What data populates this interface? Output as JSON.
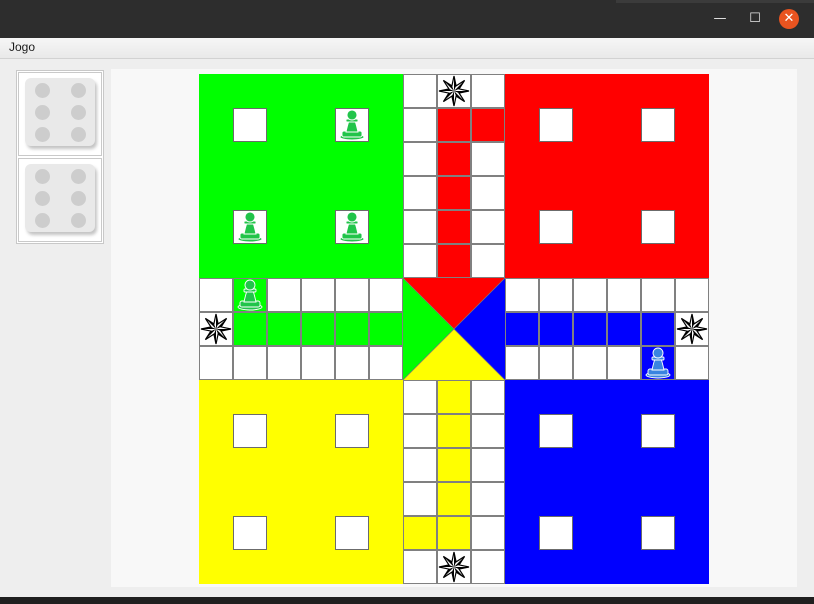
{
  "window": {
    "minimize_glyph": "—",
    "maximize_glyph": "☐",
    "close_glyph": "✕"
  },
  "menu": {
    "items": [
      "Jogo"
    ]
  },
  "dice": [
    {
      "value": 6
    },
    {
      "value": 6
    }
  ],
  "board": {
    "colors": {
      "green": "#00ff00",
      "red": "#ff0000",
      "yellow": "#ffff00",
      "blue": "#0000ff",
      "cell_border": "#808080",
      "safe_star": "#000000"
    },
    "yards": [
      {
        "color": "green",
        "pawns_in_slots": [
          false,
          true,
          true,
          true
        ]
      },
      {
        "color": "red",
        "pawns_in_slots": [
          false,
          false,
          false,
          false
        ]
      },
      {
        "color": "yellow",
        "pawns_in_slots": [
          false,
          false,
          false,
          false
        ]
      },
      {
        "color": "blue",
        "pawns_in_slots": [
          false,
          false,
          false,
          false
        ]
      }
    ],
    "pawns_on_track": [
      {
        "color": "green",
        "track": "left-top-row",
        "index": 1
      },
      {
        "color": "blue",
        "track": "right-bottom-row",
        "index": 4
      }
    ],
    "pawn_colors": {
      "green": "#21c44a",
      "blue": "#3a84e0"
    },
    "safe_stars": [
      "top-arm",
      "left-arm",
      "right-arm",
      "bottom-arm"
    ]
  }
}
